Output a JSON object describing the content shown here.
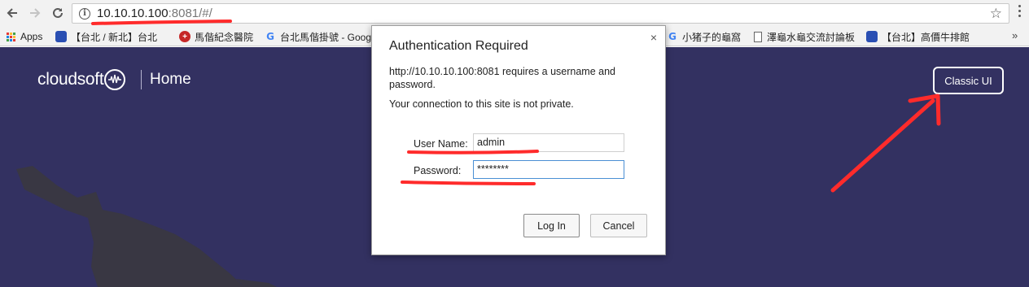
{
  "browser": {
    "url_host": "10.10.10.100",
    "url_rest": ":8081/#/"
  },
  "bookmarks": [
    {
      "label": "Apps",
      "icon": "apps-grid-icon"
    },
    {
      "label": "【台北 / 新北】台北",
      "icon": "blue-bookmark-icon"
    },
    {
      "label": "馬偕紀念醫院",
      "icon": "hospital-cross-icon"
    },
    {
      "label": "台北馬偕掛號 - Goog",
      "icon": "google-icon"
    },
    {
      "label": "小猪子的龜窩",
      "icon": "google-icon"
    },
    {
      "label": "澤龜水龜交流討論板",
      "icon": "document-icon"
    },
    {
      "label": "【台北】高價牛排館",
      "icon": "blue-bookmark-icon"
    }
  ],
  "page": {
    "logo_text": "cloudsoft",
    "home_label": "Home",
    "classic_ui_label": "Classic UI",
    "colors": {
      "background": "#333161",
      "blob": "#393743",
      "annotation": "#ff2b2b"
    }
  },
  "dialog": {
    "title": "Authentication Required",
    "message": "http://10.10.10.100:8081 requires a username and password.",
    "privacy_note": "Your connection to this site is not private.",
    "username_label": "User Name:",
    "username_value": "admin",
    "password_label": "Password:",
    "password_value": "********",
    "login_label": "Log In",
    "cancel_label": "Cancel",
    "close_glyph": "×"
  }
}
